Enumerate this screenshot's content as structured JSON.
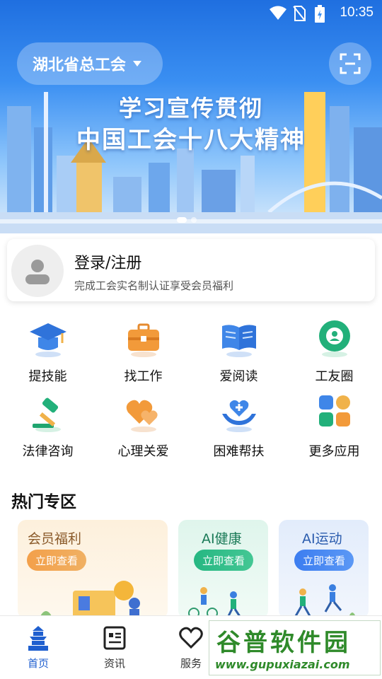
{
  "status_bar": {
    "time": "10:35"
  },
  "header": {
    "org_name": "湖北省总工会"
  },
  "banner": {
    "line1": "学习宣传贯彻",
    "line2": "中国工会十八大精神"
  },
  "login": {
    "title": "登录/注册",
    "subtitle": "完成工会实名制认证享受会员福利"
  },
  "grid": [
    {
      "label": "提技能",
      "icon": "graduation-cap-icon"
    },
    {
      "label": "找工作",
      "icon": "briefcase-icon"
    },
    {
      "label": "爱阅读",
      "icon": "open-book-icon"
    },
    {
      "label": "工友圈",
      "icon": "camera-aperture-icon"
    },
    {
      "label": "法律咨询",
      "icon": "gavel-icon"
    },
    {
      "label": "心理关爱",
      "icon": "hearts-icon"
    },
    {
      "label": "困难帮扶",
      "icon": "helping-hands-icon"
    },
    {
      "label": "更多应用",
      "icon": "apps-grid-icon"
    }
  ],
  "hot_zone": {
    "title": "热门专区",
    "cards": [
      {
        "title": "会员福利",
        "button": "立即查看"
      },
      {
        "title": "AI健康",
        "button": "立即查看"
      },
      {
        "title": "AI运动",
        "button": "立即查看"
      }
    ]
  },
  "bottom_nav": [
    {
      "label": "首页",
      "icon": "home-tower-icon",
      "active": true
    },
    {
      "label": "资讯",
      "icon": "news-icon"
    },
    {
      "label": "服务",
      "icon": "heart-icon"
    },
    {
      "label": "",
      "icon": "hidden-icon"
    },
    {
      "label": "",
      "icon": "hidden-icon"
    }
  ],
  "watermark": {
    "text": "谷普软件园",
    "url": "www.gupuxiazai.com"
  },
  "colors": {
    "primary": "#1f5fcf",
    "banner_top": "#1f6fe0",
    "welfare": "#f3a04a",
    "health": "#26b782",
    "sport": "#3c7df0"
  }
}
